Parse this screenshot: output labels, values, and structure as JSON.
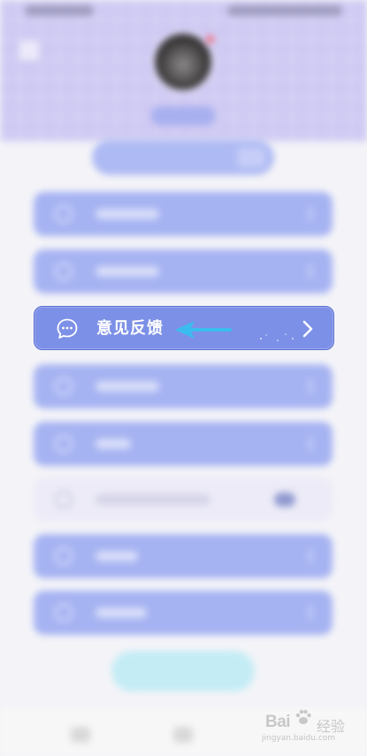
{
  "feedback_item": {
    "label": "意见反馈",
    "icon": "chat-bubble-icon",
    "chevron": "chevron-right-icon"
  },
  "annotation": {
    "icon": "arrow-left-icon",
    "color": "#3bbcf0"
  },
  "watermark": {
    "brand": "Bai",
    "brand_suffix": "经验",
    "url": "jingyan.baidu.com"
  },
  "colors": {
    "header_bg": "#cfcaf3",
    "menu_bg": "#a6b3f2",
    "highlight_bg": "#7d90e7"
  }
}
